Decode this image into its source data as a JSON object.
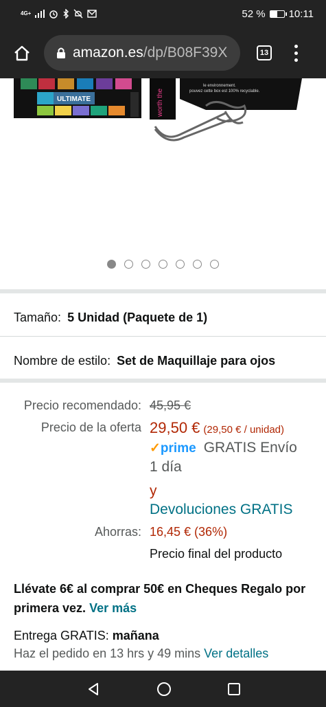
{
  "status_bar": {
    "network": "4G+",
    "battery_percent": "52 %",
    "battery_level": 0.52,
    "time": "10:11"
  },
  "browser": {
    "url_domain": "amazon.es",
    "url_path": "/dp/B08F39X",
    "tab_count": "13"
  },
  "carousel": {
    "total": 7,
    "active_index": 0
  },
  "variations": {
    "size_label": "Tamaño:",
    "size_value": "5 Unidad (Paquete de 1)",
    "style_label": "Nombre de estilo:",
    "style_value": "Set de Maquillaje para ojos"
  },
  "pricing": {
    "list_label": "Precio recomendado:",
    "list_price": "45,95 €",
    "deal_label": "Precio de la oferta",
    "deal_price": "29,50 €",
    "unit_price": "(29,50 € / unidad)",
    "prime_label": "prime",
    "free_shipping_1": "GRATIS Envío",
    "free_shipping_2": "1 día",
    "and": "y",
    "free_returns": "Devoluciones GRATIS",
    "savings_label": "Ahorras:",
    "savings_value": "16,45 € (36%)",
    "final_price_note": "Precio final del producto"
  },
  "promo": {
    "text": "Llévate 6€ al comprar 50€ en Cheques Regalo por primera vez.",
    "link": "Ver más"
  },
  "delivery": {
    "label": "Entrega GRATIS:",
    "date": "mañana",
    "countdown": "Haz el pedido en 13 hrs y 49 mins",
    "details_link": "Ver detalles"
  },
  "product_image": {
    "palette_text": "ULTIMATE",
    "mascara_text": "worth the",
    "box_text_1": "le environnement.",
    "box_text_2": "pouvez cette box est 100% recyclable."
  },
  "colors": {
    "status_bg": "#232323",
    "price_red": "#b12704",
    "link_teal": "#007185",
    "prime_blue": "#1a98ff",
    "prime_check": "#ff9900"
  }
}
